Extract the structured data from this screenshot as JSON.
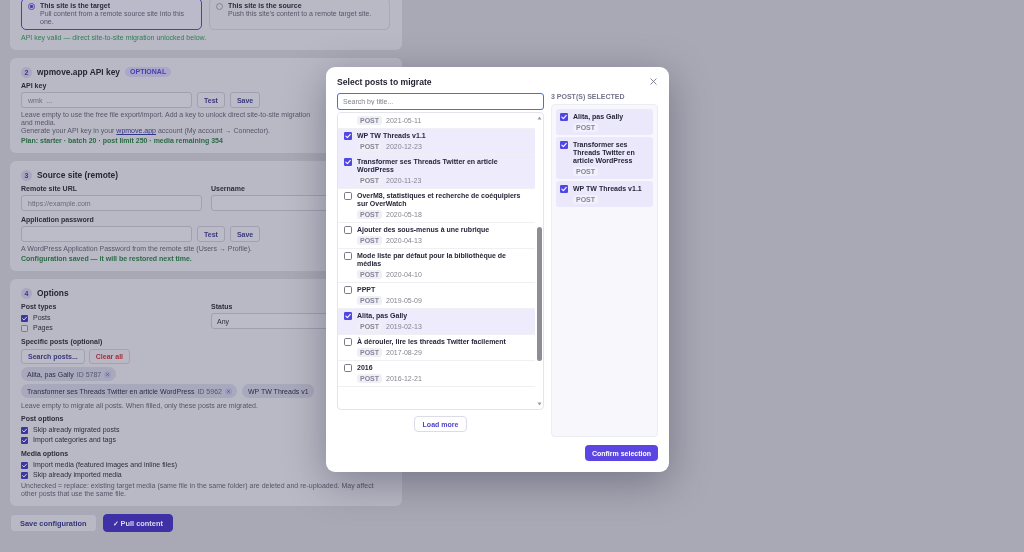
{
  "direction": {
    "options": [
      {
        "title": "This site is the target",
        "description": "Pull content from a remote source site into this one.",
        "selected": true
      },
      {
        "title": "This site is the source",
        "description": "Push this site's content to a remote target site.",
        "selected": false
      }
    ],
    "status": "API key valid — direct site-to-site migration unlocked below."
  },
  "api_key": {
    "number": "2",
    "title": "wpmove.app API key",
    "badge": "OPTIONAL",
    "label": "API key",
    "placeholder": "wmk_...",
    "buttons": [
      "Test",
      "Save"
    ],
    "help": "Leave empty to use the free file export/import. Add a key to unlock direct site-to-site migration and media.",
    "link_sentence": {
      "before": "Generate your API key in your ",
      "link": "wpmove.app",
      "after": " account (My account → Connector)."
    },
    "plan": "Plan: starter · batch 20 · post limit 250 · media remaining 354"
  },
  "source_site": {
    "number": "3",
    "title": "Source site (remote)",
    "fields": [
      {
        "label": "Remote site URL",
        "placeholder": "https://example.com"
      },
      {
        "label": "Username"
      }
    ],
    "password": {
      "label": "Application password",
      "buttons": [
        "Test",
        "Save"
      ]
    },
    "help": "A WordPress Application Password from the remote site (Users → Profile).",
    "status": "Configuration saved — it will be restored next time."
  },
  "options": {
    "number": "4",
    "title": "Options",
    "post_types": {
      "label": "Post types",
      "items": [
        {
          "label": "Posts",
          "checked": true
        },
        {
          "label": "Pages",
          "checked": false
        }
      ]
    },
    "status": {
      "label": "Status",
      "value": "Any"
    },
    "specific_posts": {
      "label": "Specific posts (optional)",
      "buttons": [
        {
          "label": "Search posts...",
          "kind": "default"
        },
        {
          "label": "Clear all",
          "kind": "danger"
        }
      ],
      "tags": [
        {
          "label": "Alita, pas Gally",
          "id": "ID 5787"
        },
        {
          "label": "Transformer ses Threads Twitter en article WordPress",
          "id": "ID 5962"
        },
        {
          "label": "WP TW Threads v1"
        }
      ],
      "help": "Leave empty to migrate all posts. When filled, only these posts are migrated."
    },
    "post_options": {
      "label": "Post options",
      "items": [
        {
          "label": "Skip already migrated posts",
          "checked": true
        },
        {
          "label": "Import categories and tags",
          "checked": true
        }
      ]
    },
    "media_options": {
      "label": "Media options",
      "items": [
        {
          "label": "Import media (featured images and inline files)",
          "checked": true
        },
        {
          "label": "Skip already imported media",
          "checked": true
        }
      ],
      "help": "Unchecked = replace: existing target media (same file in the same folder) are deleted and re-uploaded. May affect other posts that use the same file."
    }
  },
  "actions": [
    {
      "label": "Save configuration",
      "kind": "secondary"
    },
    {
      "label": "✓ Pull content",
      "kind": "primary"
    }
  ],
  "modal": {
    "title": "Select posts to migrate",
    "search": {
      "placeholder": "Search by title...",
      "focused": true
    },
    "posts": [
      {
        "type": "POST",
        "date": "2021-05-11"
      },
      {
        "title": "WP TW Threads v1.1",
        "type": "POST",
        "date": "2020-12-23",
        "checked": true
      },
      {
        "title": "Transformer ses Threads Twitter en article WordPress",
        "type": "POST",
        "date": "2020-11-23",
        "checked": true
      },
      {
        "title": "OverM8, statistiques et recherche de coéquipiers sur OverWatch",
        "type": "POST",
        "date": "2020-05-18",
        "checked": false
      },
      {
        "title": "Ajouter des sous-menus à une rubrique",
        "type": "POST",
        "date": "2020-04-13",
        "checked": false
      },
      {
        "title": "Mode liste par défaut pour la bibliothèque de médias",
        "type": "POST",
        "date": "2020-04-10",
        "checked": false
      },
      {
        "title": "PPPT",
        "type": "POST",
        "date": "2019-05-09",
        "checked": false
      },
      {
        "title": "Alita, pas Gally",
        "type": "POST",
        "date": "2019-02-13",
        "checked": true
      },
      {
        "title": "À dérouler, lire les threads Twitter facilement",
        "type": "POST",
        "date": "2017-08-29",
        "checked": false
      },
      {
        "title": "2016",
        "type": "POST",
        "date": "2016-12-21",
        "checked": false
      }
    ],
    "load_more": "Load more",
    "selected_heading": "3 POST(S) SELECTED",
    "selected_posts": [
      {
        "title": "Alita, pas Gally",
        "type": "POST",
        "checked": true
      },
      {
        "title": "Transformer ses Threads Twitter en article WordPress",
        "type": "POST",
        "checked": true
      },
      {
        "title": "WP TW Threads v1.1",
        "type": "POST",
        "checked": true
      }
    ],
    "confirm": "Confirm selection"
  }
}
